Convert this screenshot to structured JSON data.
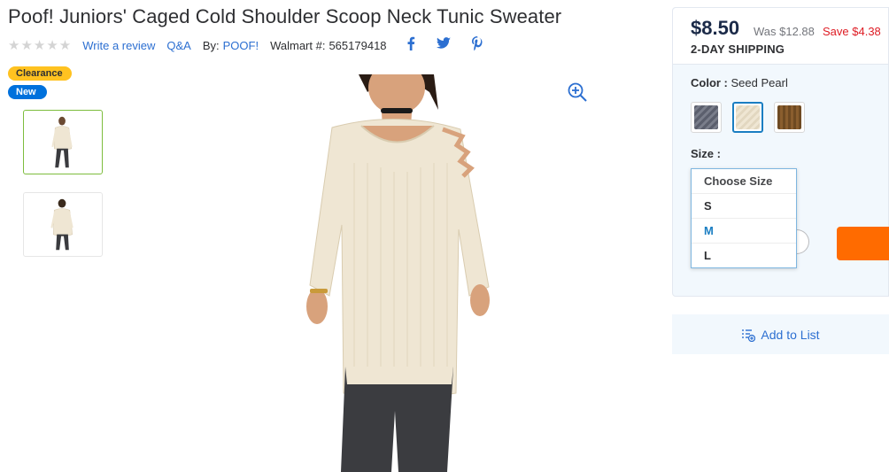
{
  "product": {
    "title": "Poof! Juniors' Caged Cold Shoulder Scoop Neck Tunic Sweater",
    "rating_stars": "★★★★★",
    "write_review": "Write a review",
    "qa": "Q&A",
    "by_label": "By:",
    "brand": "POOF!",
    "walmart_label": "Walmart #:",
    "walmart_number": "565179418",
    "badges": {
      "clearance": "Clearance",
      "new": "New"
    }
  },
  "social": {
    "facebook": "f",
    "twitter": "🐦",
    "pinterest": "P"
  },
  "buybox": {
    "price": "$8.50",
    "was": "Was $12.88",
    "save": "Save $4.38",
    "shipping": "2-DAY SHIPPING",
    "color_label": "Color :",
    "color_value": "Seed Pearl",
    "swatches": [
      "#6b6f7d",
      "#efe6d3",
      "#6e4a22"
    ],
    "size_label": "Size :"
  },
  "size_dropdown": {
    "header": "Choose Size",
    "options": [
      "S",
      "M",
      "L"
    ],
    "highlighted": "M"
  },
  "add_to_list": "Add to List",
  "colors": {
    "link": "#2c6fd1",
    "save_red": "#de1c24",
    "cart_orange": "#ff6b00",
    "clearance_yellow": "#ffc220",
    "new_blue": "#0071dc"
  }
}
